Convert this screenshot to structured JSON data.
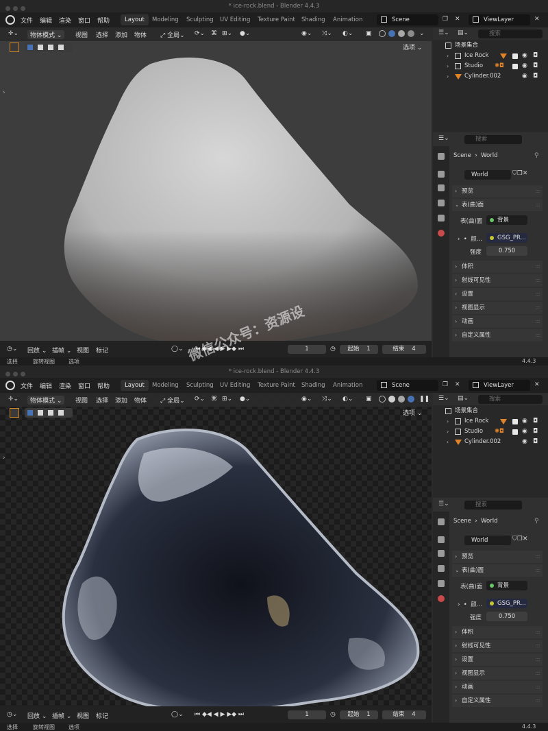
{
  "window": {
    "title": "* ice-rock.blend - Blender 4.4.3"
  },
  "menu": {
    "file": "文件",
    "edit": "编辑",
    "render": "渲染",
    "window": "窗口",
    "help": "帮助"
  },
  "workspaces": [
    {
      "label": "Layout",
      "active": true
    },
    {
      "label": "Modeling"
    },
    {
      "label": "Sculpting"
    },
    {
      "label": "UV Editing"
    },
    {
      "label": "Texture Paint"
    },
    {
      "label": "Shading"
    },
    {
      "label": "Animation"
    }
  ],
  "scene": {
    "name": "Scene"
  },
  "view_layer": {
    "name": "ViewLayer"
  },
  "viewport_header": {
    "mode": "物体模式",
    "view": "视图",
    "select": "选择",
    "add": "添加",
    "object": "物体",
    "transform_orientation": "全局",
    "options": "选项"
  },
  "outliner": {
    "search_placeholder": "搜索",
    "collection": "场景集合",
    "items": [
      {
        "name": "Ice Rock"
      },
      {
        "name": "Studio"
      },
      {
        "name": "Cylinder.002"
      }
    ]
  },
  "properties": {
    "search_placeholder": "搜索",
    "breadcrumb_scene": "Scene",
    "breadcrumb_world": "World",
    "world_name": "World",
    "panels": {
      "preview": "预览",
      "surface": "表(曲)面",
      "surface_label": "表(曲)面",
      "surface_value": "背景",
      "color_label": "颜...",
      "color_value": "GSG_PR...",
      "strength_label": "强度",
      "strength_value": "0.750",
      "volume": "体积",
      "ray_visibility": "射线可见性",
      "settings": "设置",
      "viewport_display": "视图显示",
      "animation": "动画",
      "custom_props": "自定义属性"
    }
  },
  "timeline": {
    "playback": "回放",
    "keying": "插帧",
    "view": "视图",
    "marker": "标记",
    "current_frame": "1",
    "start_label": "起始",
    "start": "1",
    "end_label": "结束",
    "end": "4"
  },
  "status": {
    "select": "选择",
    "rotate_view": "旋转视图",
    "options": "选项",
    "version": "4.4.3"
  },
  "watermark": "微信公众号：资源设",
  "colors": {
    "accent_blue": "#4772b3",
    "orange": "#e0842a",
    "green_socket": "#63c763",
    "yellow_socket": "#c7c729"
  }
}
